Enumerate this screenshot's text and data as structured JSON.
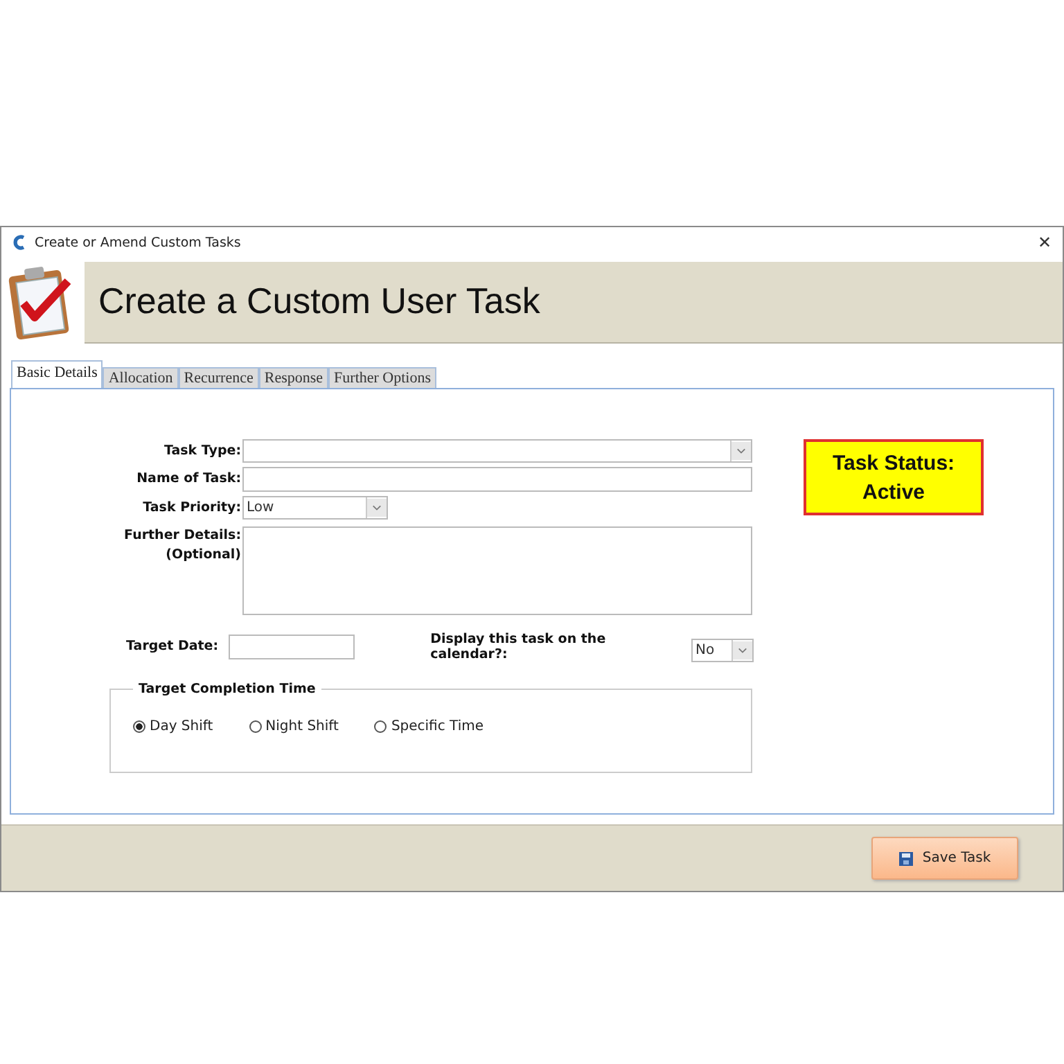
{
  "window": {
    "title": "Create or Amend Custom Tasks",
    "close": "✕"
  },
  "header": {
    "title": "Create a Custom User Task"
  },
  "tabs": [
    {
      "label": "Basic Details",
      "selected": true
    },
    {
      "label": "Allocation",
      "selected": false
    },
    {
      "label": "Recurrence",
      "selected": false
    },
    {
      "label": "Response",
      "selected": false
    },
    {
      "label": "Further Options",
      "selected": false
    }
  ],
  "form": {
    "fields": [
      {
        "kind": "select",
        "label": "Task Type:"
      },
      {
        "kind": "text",
        "label": "Name of Task:"
      },
      {
        "kind": "select",
        "label": "Task Priority:",
        "value": "Low"
      },
      {
        "kind": "textarea",
        "label": "Further Details:",
        "sublabel": "(Optional)"
      }
    ],
    "target_date": {
      "label": "Target Date:"
    },
    "calendar": {
      "label": "Display this task on the calendar?:",
      "value": "No"
    }
  },
  "completion_time": {
    "title": "Target Completion Time",
    "options": [
      {
        "label": "Day Shift",
        "selected": true
      },
      {
        "label": "Night Shift",
        "selected": false
      },
      {
        "label": "Specific Time",
        "selected": false
      }
    ]
  },
  "status": {
    "label": "Task Status:",
    "value": "Active"
  },
  "footer": {
    "button": "Save Task"
  }
}
